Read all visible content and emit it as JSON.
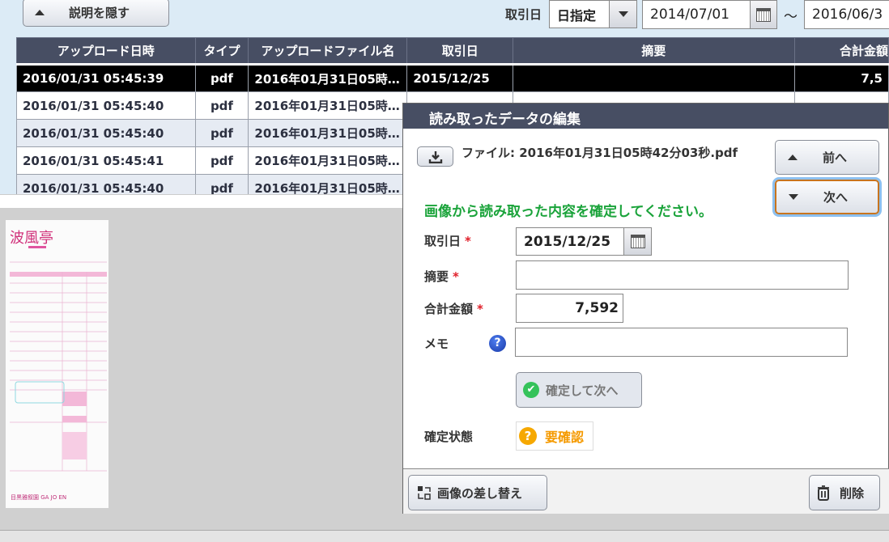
{
  "toolbar": {
    "hide_description_label": "説明を隠す",
    "date_filter_label": "取引日",
    "date_mode": "日指定",
    "date_from": "2014/07/01",
    "range_separator": "〜",
    "date_to": "2016/06/3"
  },
  "table": {
    "columns": [
      "アップロード日時",
      "タイプ",
      "アップロードファイル名",
      "取引日",
      "摘要",
      "合計金額"
    ],
    "rows": [
      [
        "2016/01/31 05:45:39",
        "pdf",
        "2016年01月31日05時…",
        "2015/12/25",
        "",
        "7,5"
      ],
      [
        "2016/01/31 05:45:40",
        "pdf",
        "2016年01月31日05時…",
        "",
        "",
        ""
      ],
      [
        "2016/01/31 05:45:40",
        "pdf",
        "2016年01月31日05時…",
        "",
        "",
        ""
      ],
      [
        "2016/01/31 05:45:41",
        "pdf",
        "2016年01月31日05時…",
        "",
        "",
        ""
      ],
      [
        "2016/01/31 05:45:40",
        "pdf",
        "2016年01月31日05時…",
        "",
        "",
        ""
      ]
    ]
  },
  "receipt": {
    "logo_text": "波風亭",
    "footer_text": "目黒雅叙園 GA JO EN"
  },
  "dialog": {
    "title": "読み取ったデータの編集",
    "file_label": "ファイル: 2016年01月31日05時42分03秒.pdf",
    "prev_label": "前へ",
    "next_label": "次へ",
    "instruction": "画像から読み取った内容を確定してください。",
    "instruction_color": "#1aa33a",
    "fields": {
      "date_label": "取引日",
      "date_value": "2015/12/25",
      "summary_label": "摘要",
      "summary_value": "",
      "amount_label": "合計金額",
      "amount_value": "7,592",
      "memo_label": "メモ",
      "memo_value": "",
      "required_mark": "*"
    },
    "confirm_next_label": "確定して次へ",
    "status_label": "確定状態",
    "status_value": "要確認",
    "status_color": "#f59a00",
    "replace_image_label": "画像の差し替え",
    "delete_label": "削除"
  }
}
